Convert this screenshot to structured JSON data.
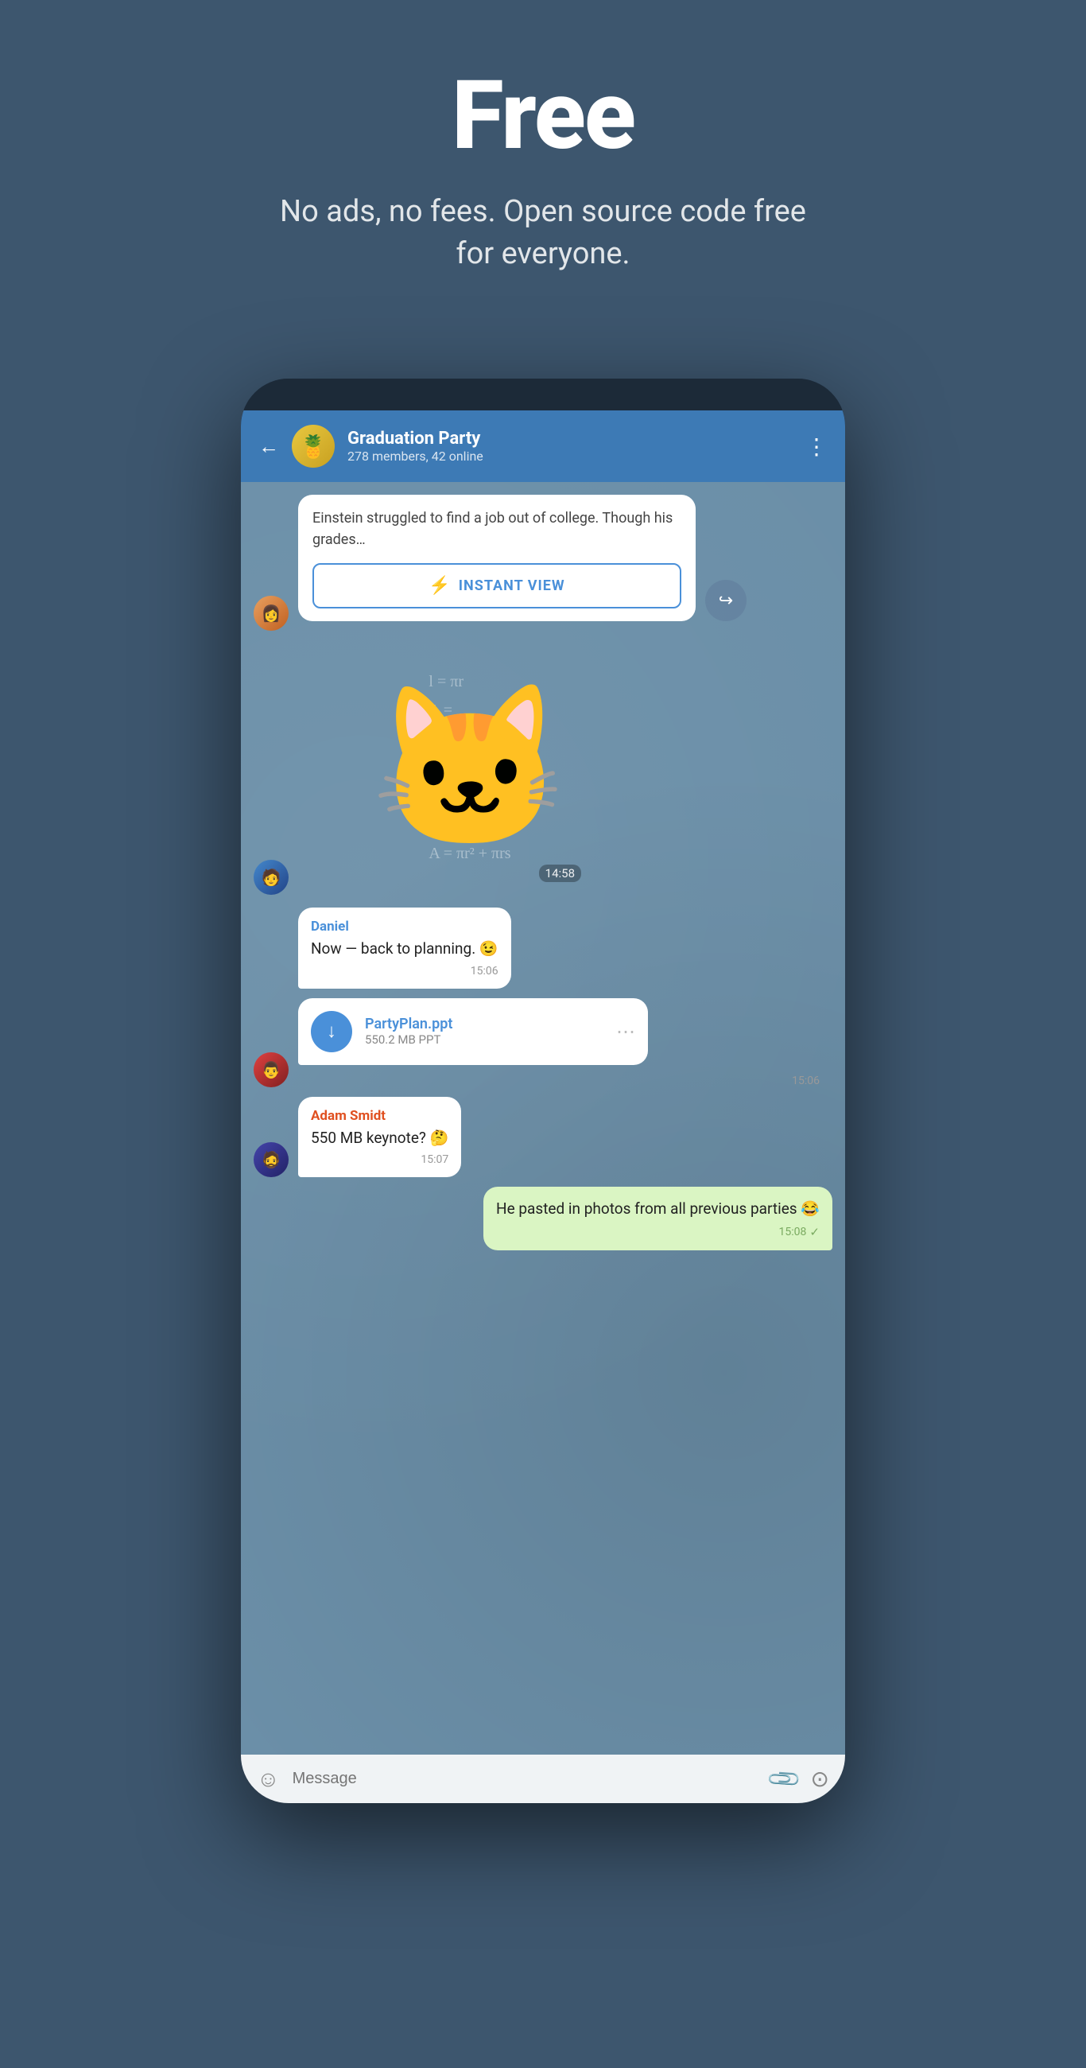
{
  "hero": {
    "title": "Free",
    "subtitle": "No ads, no fees. Open source code free for everyone."
  },
  "chat": {
    "back_label": "←",
    "group_name": "Graduation Party",
    "group_members": "278 members, 42 online",
    "more_icon": "⋮",
    "article_text": "Einstein struggled to find a job out of college. Though his grades…",
    "instant_view_label": "INSTANT VIEW",
    "iv_icon": "⚡",
    "sticker_time": "14:58",
    "messages": [
      {
        "sender": "Daniel",
        "text": "Now — back to planning. 😉",
        "time": "15:06",
        "type": "text",
        "side": "right_no",
        "avatar": "person2"
      },
      {
        "file_name": "PartyPlan.ppt",
        "file_size": "550.2 MB PPT",
        "time": "15:06",
        "type": "file",
        "side": "left",
        "avatar": "person3"
      },
      {
        "sender": "Adam Smidt",
        "text": "550 MB keynote? 🤔",
        "time": "15:07",
        "type": "text",
        "side": "left",
        "avatar": "person4"
      },
      {
        "text": "He pasted in photos from all previous parties 😂",
        "time": "15:08",
        "type": "text",
        "side": "right",
        "checkmark": true
      }
    ]
  },
  "input": {
    "placeholder": "Message"
  }
}
